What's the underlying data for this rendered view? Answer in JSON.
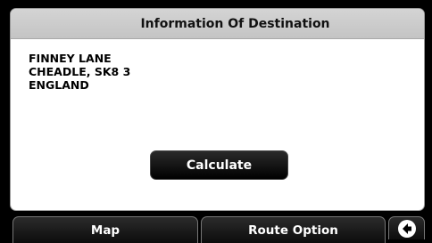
{
  "header": {
    "title": "Information Of Destination"
  },
  "destination": {
    "lines": [
      "FINNEY LANE",
      "CHEADLE, SK8 3",
      "ENGLAND"
    ]
  },
  "actions": {
    "calculate_label": "Calculate"
  },
  "bottom_nav": {
    "map_label": "Map",
    "route_option_label": "Route Option",
    "back_icon": "back-arrow-icon"
  }
}
